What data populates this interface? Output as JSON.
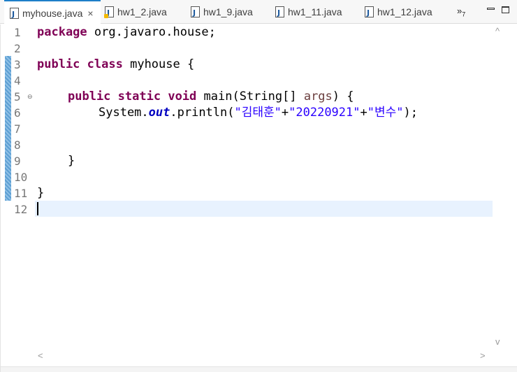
{
  "tabs": [
    {
      "label": "myhouse.java",
      "active": true,
      "close": "×",
      "warning": false
    },
    {
      "label": "hw1_2.java",
      "active": false,
      "warning": true
    },
    {
      "label": "hw1_9.java",
      "active": false,
      "warning": false
    },
    {
      "label": "hw1_11.java",
      "active": false,
      "warning": false
    },
    {
      "label": "hw1_12.java",
      "active": false,
      "warning": false
    }
  ],
  "overflow": {
    "chevron": "»",
    "count": "7"
  },
  "editor": {
    "line_numbers": [
      "1",
      "2",
      "3",
      "4",
      "5",
      "6",
      "7",
      "8",
      "9",
      "10",
      "11",
      "12"
    ],
    "fold_marker": "⊖",
    "code": {
      "l1": {
        "kw": "package",
        "rest": " org.javaro.house;"
      },
      "l3": {
        "kw1": "public",
        "kw2": "class",
        "rest": " myhouse {"
      },
      "l5": {
        "kw1": "public",
        "kw2": "static",
        "kw3": "void",
        "mid": " main(String[] ",
        "param": "args",
        "end": ") {"
      },
      "l6": {
        "a": "System.",
        "field": "out",
        "b": ".println(",
        "s1": "\"김태훈\"",
        "p1": "+",
        "s2": "\"20220921\"",
        "p2": "+",
        "s3": "\"변수\"",
        "c": ");"
      },
      "l9": "}",
      "l11": "}"
    },
    "current_line": "12"
  },
  "scroll": {
    "up": "^",
    "down": "v",
    "left": "<",
    "right": ">"
  },
  "colors": {
    "keyword": "#7f0055",
    "string": "#2a00ff",
    "field": "#0000c0",
    "accent": "#1e7fc9",
    "current_line": "#e8f2fe"
  }
}
